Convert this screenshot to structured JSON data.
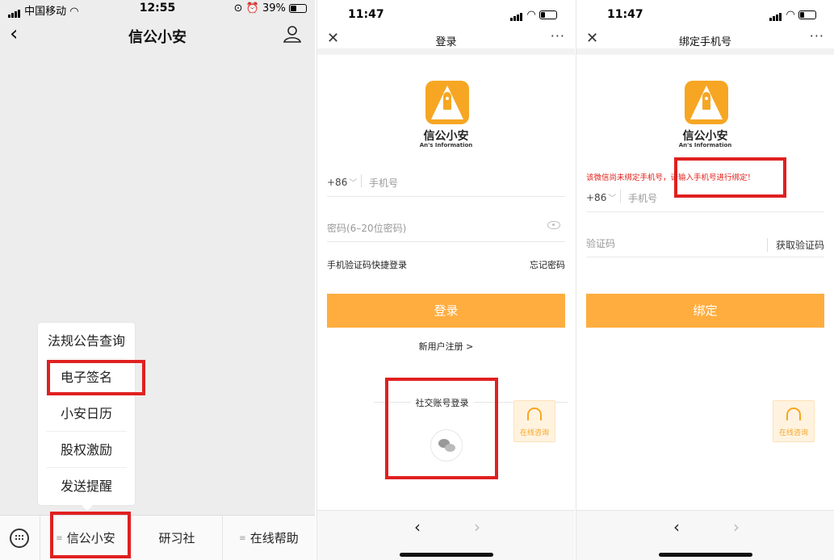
{
  "panel1": {
    "status": {
      "carrier": "中国移动",
      "time": "12:55",
      "battery": "39%"
    },
    "title": "信公小安",
    "menu": [
      "法规公告查询",
      "电子签名",
      "小安日历",
      "股权激励",
      "发送提醒"
    ],
    "tabs": [
      "信公小安",
      "研习社",
      "在线帮助"
    ]
  },
  "panel2": {
    "status": {
      "time": "11:47"
    },
    "title": "登录",
    "more": "···",
    "brand": "信公小安",
    "brand_en": "An's Information",
    "country_code": "+86",
    "phone_placeholder": "手机号",
    "password_placeholder": "密码(6–20位密码)",
    "sms_login": "手机验证码快捷登录",
    "forgot": "忘记密码",
    "login_button": "登录",
    "register": "新用户注册 >",
    "social_login": "社交账号登录",
    "consult": "在线咨询"
  },
  "panel3": {
    "status": {
      "time": "11:47"
    },
    "title": "绑定手机号",
    "more": "···",
    "brand": "信公小安",
    "brand_en": "An's Information",
    "warning": "该微信尚未绑定手机号，请输入手机号进行绑定！",
    "country_code": "+86",
    "phone_placeholder": "手机号",
    "code_placeholder": "验证码",
    "get_code": "获取验证码",
    "bind_button": "绑定",
    "consult": "在线咨询"
  },
  "colors": {
    "accent": "#ffad3f",
    "highlight": "#e02020",
    "warning": "#e2201a"
  }
}
